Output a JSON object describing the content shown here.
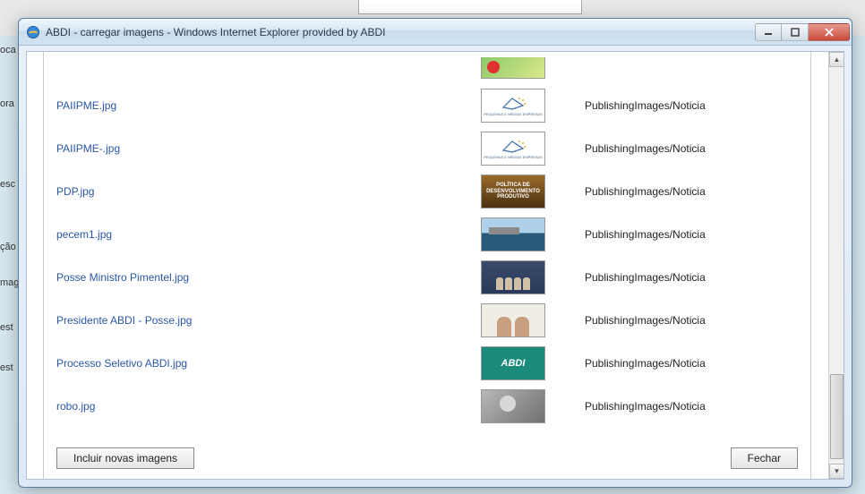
{
  "window": {
    "title": "ABDI - carregar imagens - Windows Internet Explorer provided by ABDI"
  },
  "bg_labels": [
    "oca",
    "ora",
    "esc",
    "ção",
    "mag",
    "est",
    "est"
  ],
  "files": [
    {
      "name": "",
      "folder": "",
      "thumb": "t-green",
      "partial": true
    },
    {
      "name": "PAIIPME.jpg",
      "folder": "PublishingImages/Noticia",
      "thumb": "t-logo"
    },
    {
      "name": "PAIIPME-.jpg",
      "folder": "PublishingImages/Noticia",
      "thumb": "t-logo"
    },
    {
      "name": "PDP.jpg",
      "folder": "PublishingImages/Noticia",
      "thumb": "t-pdp"
    },
    {
      "name": "pecem1.jpg",
      "folder": "PublishingImages/Noticia",
      "thumb": "t-pecem"
    },
    {
      "name": "Posse Ministro Pimentel.jpg",
      "folder": "PublishingImages/Noticia",
      "thumb": "t-conf"
    },
    {
      "name": "Presidente ABDI - Posse.jpg",
      "folder": "PublishingImages/Noticia",
      "thumb": "t-people"
    },
    {
      "name": "Processo Seletivo ABDI.jpg",
      "folder": "PublishingImages/Noticia",
      "thumb": "t-abdi"
    },
    {
      "name": "robo.jpg",
      "folder": "PublishingImages/Noticia",
      "thumb": "t-robo"
    }
  ],
  "thumb_text": {
    "logo_caption": "PEQUENAS E MÉDIAS EMPRESAS",
    "pdp": "POLÍTICA DE DESENVOLVIMENTO PRODUTIVO",
    "abdi": "ABDI"
  },
  "footer": {
    "include_label": "Incluir novas imagens",
    "close_label": "Fechar"
  }
}
